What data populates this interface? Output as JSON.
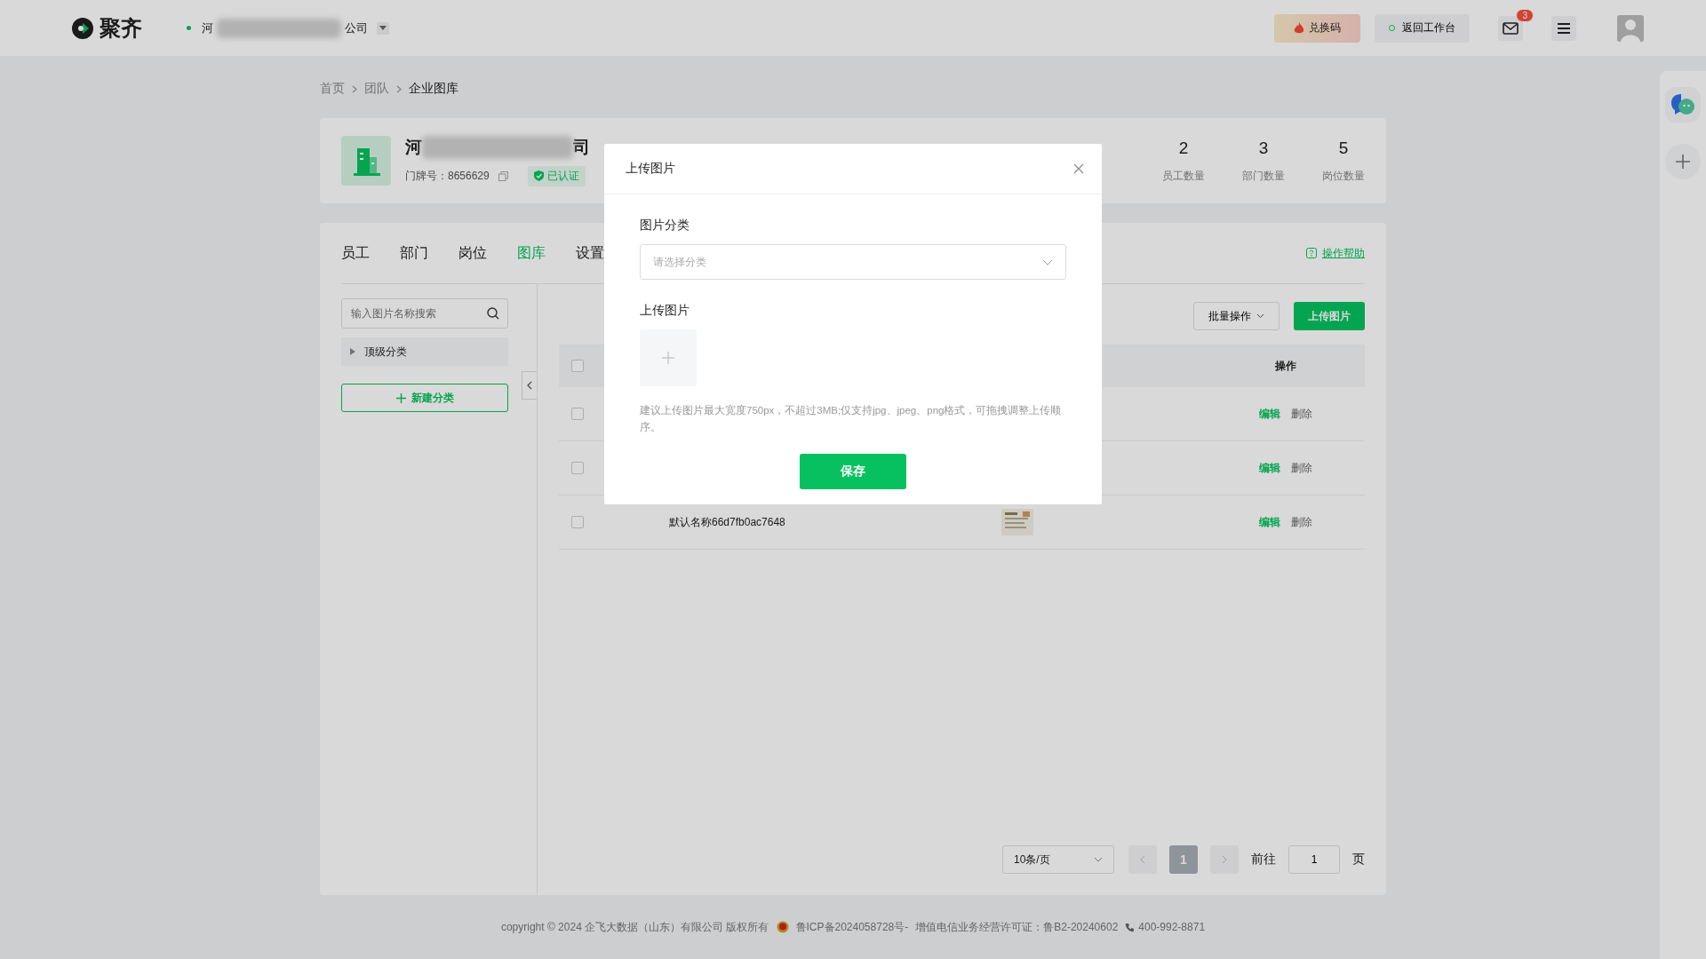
{
  "topbar": {
    "logo_text": "聚齐",
    "company_start": "河",
    "company_end": "公司",
    "redeem_button": "兑换码",
    "workbench_button": "返回工作台",
    "mail_badge": "3"
  },
  "breadcrumb": [
    {
      "label": "首页",
      "current": false
    },
    {
      "label": "团队",
      "current": false
    },
    {
      "label": "企业图库",
      "current": true
    }
  ],
  "company": {
    "name_start": "河",
    "name_end": "司",
    "door_label": "门牌号：8656629",
    "verified": "已认证",
    "stats": [
      {
        "value": "2",
        "label": "员工数量"
      },
      {
        "value": "3",
        "label": "部门数量"
      },
      {
        "value": "5",
        "label": "岗位数量"
      }
    ]
  },
  "tabs": [
    {
      "label": "员工",
      "selected": false
    },
    {
      "label": "部门",
      "selected": false
    },
    {
      "label": "岗位",
      "selected": false
    },
    {
      "label": "图库",
      "selected": true
    },
    {
      "label": "设置",
      "selected": false
    }
  ],
  "help_link": "操作帮助",
  "sidebar": {
    "search_placeholder": "输入图片名称搜索",
    "categories": [
      {
        "label": "顶级分类",
        "expanded": false
      }
    ],
    "new_category_button": "新建分类"
  },
  "toolbar": {
    "batch_button": "批量操作",
    "upload_button": "上传图片"
  },
  "table": {
    "header_checked": false,
    "columns": [
      {
        "label": "操作"
      }
    ],
    "rows": [
      {
        "checked": false,
        "actions": [
          "编辑",
          "删除"
        ]
      },
      {
        "checked": false,
        "actions": [
          "编辑",
          "删除"
        ]
      },
      {
        "checked": false,
        "name": "默认名称66d7fb0ac7648",
        "thumbnail": {
          "kind": "picture"
        },
        "actions": [
          "编辑",
          "删除"
        ]
      }
    ]
  },
  "pagination": {
    "page_size": "10条/页",
    "pages": [
      {
        "label": "1",
        "selected": true
      }
    ],
    "goto_label": "前往",
    "goto_value": "1",
    "page_unit": "页"
  },
  "footer": {
    "copyright": "copyright © 2024 企飞大数据（山东）有限公司 版权所有",
    "icp": "鲁ICP备2024058728号-",
    "license": "增值电信业务经营许可证：鲁B2-20240602",
    "phone": "400-992-8871"
  },
  "modal": {
    "title": "上传图片",
    "category_label": "图片分类",
    "category_placeholder": "请选择分类",
    "upload_label": "上传图片",
    "hint": "建议上传图片最大宽度750px，不超过3MB;仅支持jpg、jpeg、png格式，可拖拽调整上传顺序。",
    "save_button": "保存"
  }
}
